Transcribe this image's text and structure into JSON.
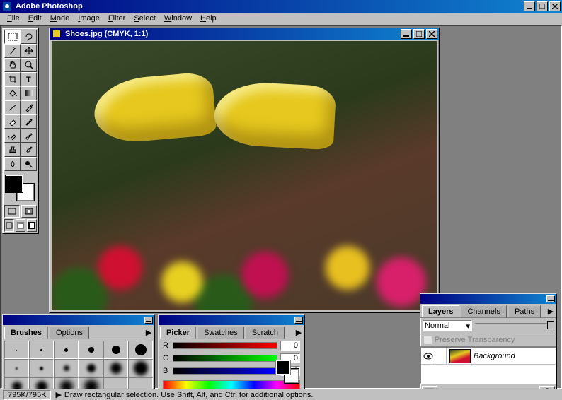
{
  "app": {
    "title": "Adobe Photoshop"
  },
  "menu": [
    "File",
    "Edit",
    "Mode",
    "Image",
    "Filter",
    "Select",
    "Window",
    "Help"
  ],
  "document": {
    "title": "Shoes.jpg  (CMYK, 1:1)"
  },
  "brushes": {
    "tabs": [
      "Brushes",
      "Options"
    ],
    "sizes_row3": [
      "35",
      "45",
      "65",
      "100"
    ]
  },
  "picker": {
    "tabs": [
      "Picker",
      "Swatches",
      "Scratch"
    ],
    "channels": [
      {
        "label": "R",
        "value": "0"
      },
      {
        "label": "G",
        "value": "0"
      },
      {
        "label": "B",
        "value": "0"
      }
    ]
  },
  "layers": {
    "tabs": [
      "Layers",
      "Channels",
      "Paths"
    ],
    "blend_mode": "Normal",
    "preserve_label": "Preserve Transparency",
    "items": [
      {
        "name": "Background",
        "visible": true
      }
    ]
  },
  "status": {
    "size": "795K/795K",
    "hint": "Draw rectangular selection.  Use Shift, Alt, and Ctrl for additional options."
  }
}
